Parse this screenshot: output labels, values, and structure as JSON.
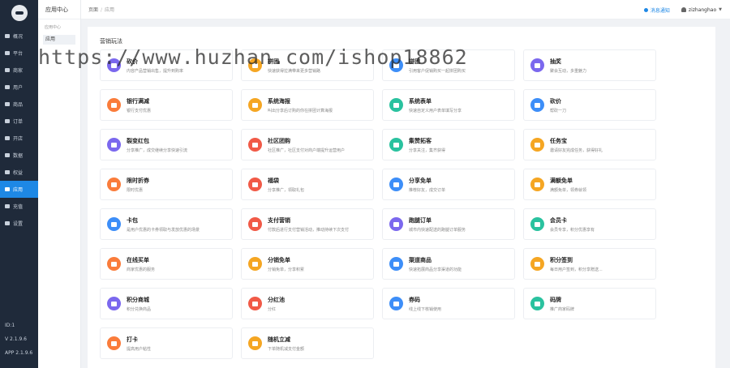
{
  "sidebar": {
    "items": [
      {
        "label": "概况",
        "active": false
      },
      {
        "label": "平台",
        "active": false
      },
      {
        "label": "商家",
        "active": false
      },
      {
        "label": "用户",
        "active": false
      },
      {
        "label": "商品",
        "active": false
      },
      {
        "label": "订单",
        "active": false
      },
      {
        "label": "开店",
        "active": false
      },
      {
        "label": "数据",
        "active": false
      },
      {
        "label": "权益",
        "active": false
      },
      {
        "label": "应用",
        "active": true
      },
      {
        "label": "充值",
        "active": false
      },
      {
        "label": "设置",
        "active": false
      }
    ],
    "id_text": "ID:1",
    "version": "V 2.1.9.6",
    "app_version": "APP 2.1.9.6"
  },
  "subsidebar": {
    "title": "应用中心",
    "group": "应用中心",
    "item": "应用"
  },
  "topbar": {
    "crumb_home": "页面",
    "crumb_sep": "/",
    "crumb_current": "应用",
    "message": "消息通知",
    "username": "zizhanghao"
  },
  "section_title": "营销玩法",
  "watermark": "https://www.huzhan.com/ishop18862",
  "apps": [
    {
      "name": "砍价",
      "desc": "内容产品营销出售，提升到购率",
      "color": "#7b68ee"
    },
    {
      "name": "拼团",
      "desc": "快速获得拉满带来更多营销路",
      "color": "#f5a623"
    },
    {
      "name": "拼团",
      "desc": "引用客户促销购买一起拼团购买",
      "color": "#3d8ef8"
    },
    {
      "name": "抽奖",
      "desc": "聚会互动，多重魅力",
      "color": "#7b68ee"
    },
    {
      "name": "银行满减",
      "desc": "银行支付优惠",
      "color": "#fa7c3b"
    },
    {
      "name": "系统海报",
      "desc": "叫出分享后订购的你在拼团计算海报",
      "color": "#f5a623"
    },
    {
      "name": "系统表单",
      "desc": "快速自定义用户表单填写分享",
      "color": "#2ac29f"
    },
    {
      "name": "砍价",
      "desc": "帮砍一刀",
      "color": "#3d8ef8"
    },
    {
      "name": "裂变红包",
      "desc": "分享推广，成交继续分享快速引流",
      "color": "#7b68ee"
    },
    {
      "name": "社区团购",
      "desc": "社区推广，社区支付对商户端提升运营用户",
      "color": "#f15a47"
    },
    {
      "name": "集赞拓客",
      "desc": "分享关注，集齐获得",
      "color": "#2ac29f"
    },
    {
      "name": "任务宝",
      "desc": "邀请好友完成任务，获得好礼",
      "color": "#f5a623"
    },
    {
      "name": "限时折券",
      "desc": "限时优惠",
      "color": "#fa7c3b"
    },
    {
      "name": "福袋",
      "desc": "分享推广，领取礼包",
      "color": "#f15a47"
    },
    {
      "name": "分享免单",
      "desc": "推荐好友，成交订单",
      "color": "#3d8ef8"
    },
    {
      "name": "满额免单",
      "desc": "满额免单，领券就领",
      "color": "#f5a623"
    },
    {
      "name": "卡包",
      "desc": "是用户优惠的卡券领取与发放优惠的场景",
      "color": "#3d8ef8"
    },
    {
      "name": "支付营销",
      "desc": "付款后进行支付营销活动，推动持续下次支付",
      "color": "#f15a47"
    },
    {
      "name": "跑腿订单",
      "desc": "城市内快速配送的跑腿订单服务",
      "color": "#7b68ee"
    },
    {
      "name": "会员卡",
      "desc": "会员专享，积分优惠享有",
      "color": "#2ac29f"
    },
    {
      "name": "在线买单",
      "desc": "商家优惠的服务",
      "color": "#fa7c3b"
    },
    {
      "name": "分销免单",
      "desc": "分销免单，分享积累",
      "color": "#f5a623"
    },
    {
      "name": "渠道商品",
      "desc": "快速拓展商品分享渠道的功能",
      "color": "#3d8ef8"
    },
    {
      "name": "积分签到",
      "desc": "每日用户签到，积分享赠送...",
      "color": "#f5a623"
    },
    {
      "name": "积分商城",
      "desc": "积分兑换商品",
      "color": "#7b68ee"
    },
    {
      "name": "分红池",
      "desc": "分红",
      "color": "#f15a47"
    },
    {
      "name": "券码",
      "desc": "线上线下核销使用",
      "color": "#3d8ef8"
    },
    {
      "name": "码牌",
      "desc": "推广商家码牌",
      "color": "#2ac29f"
    },
    {
      "name": "打卡",
      "desc": "提高用户粘性",
      "color": "#fa7c3b"
    },
    {
      "name": "随机立减",
      "desc": "下单随机减支付金额",
      "color": "#f5a623"
    }
  ]
}
